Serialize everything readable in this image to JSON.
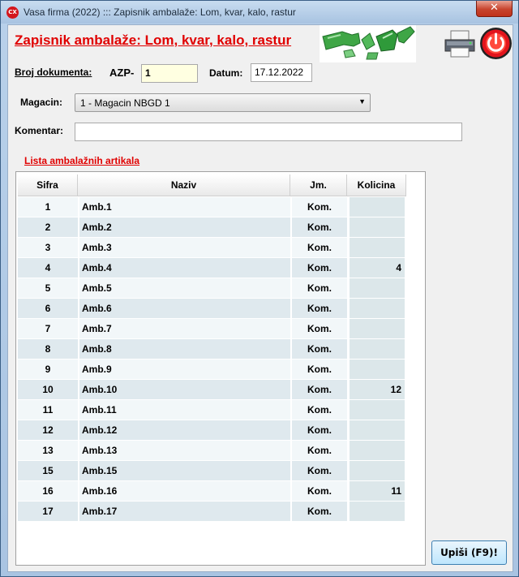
{
  "window": {
    "title": "Vasa firma (2022) ::: Zapisnik ambalaže: Lom, kvar, kalo, rastur",
    "icon_text": "CX",
    "close_label": "✕"
  },
  "header": {
    "title": "Zapisnik ambalaže: Lom, kvar, kalo, rastur",
    "image_icon": "broken-bottles-image",
    "print_icon": "printer-icon",
    "exit_icon": "power-icon"
  },
  "form": {
    "doc_label": "Broj dokumenta:",
    "doc_prefix": "AZP-",
    "doc_number": "1",
    "date_label": "Datum:",
    "date_value": "17.12.2022",
    "warehouse_label": "Magacin:",
    "warehouse_value": "1 - Magacin NBGD 1",
    "comment_label": "Komentar:",
    "comment_value": ""
  },
  "list": {
    "title": "Lista ambalažnih artikala",
    "columns": [
      "Sifra",
      "Naziv",
      "Jm.",
      "Kolicina"
    ],
    "rows": [
      {
        "sifra": "1",
        "naziv": "Amb.1",
        "jm": "Kom.",
        "kolicina": ""
      },
      {
        "sifra": "2",
        "naziv": "Amb.2",
        "jm": "Kom.",
        "kolicina": ""
      },
      {
        "sifra": "3",
        "naziv": "Amb.3",
        "jm": "Kom.",
        "kolicina": ""
      },
      {
        "sifra": "4",
        "naziv": "Amb.4",
        "jm": "Kom.",
        "kolicina": "4"
      },
      {
        "sifra": "5",
        "naziv": "Amb.5",
        "jm": "Kom.",
        "kolicina": ""
      },
      {
        "sifra": "6",
        "naziv": "Amb.6",
        "jm": "Kom.",
        "kolicina": ""
      },
      {
        "sifra": "7",
        "naziv": "Amb.7",
        "jm": "Kom.",
        "kolicina": ""
      },
      {
        "sifra": "8",
        "naziv": "Amb.8",
        "jm": "Kom.",
        "kolicina": ""
      },
      {
        "sifra": "9",
        "naziv": "Amb.9",
        "jm": "Kom.",
        "kolicina": ""
      },
      {
        "sifra": "10",
        "naziv": "Amb.10",
        "jm": "Kom.",
        "kolicina": "12"
      },
      {
        "sifra": "11",
        "naziv": "Amb.11",
        "jm": "Kom.",
        "kolicina": ""
      },
      {
        "sifra": "12",
        "naziv": "Amb.12",
        "jm": "Kom.",
        "kolicina": ""
      },
      {
        "sifra": "13",
        "naziv": "Amb.13",
        "jm": "Kom.",
        "kolicina": ""
      },
      {
        "sifra": "15",
        "naziv": "Amb.15",
        "jm": "Kom.",
        "kolicina": ""
      },
      {
        "sifra": "16",
        "naziv": "Amb.16",
        "jm": "Kom.",
        "kolicina": "11"
      },
      {
        "sifra": "17",
        "naziv": "Amb.17",
        "jm": "Kom.",
        "kolicina": ""
      }
    ]
  },
  "actions": {
    "save_label": "Upiši (F9)!"
  },
  "colors": {
    "title_red": "#e00000",
    "row_even": "#f2f7f9",
    "row_odd": "#dfe9ee",
    "qty_cell": "#dce7ea",
    "doc_number_bg": "#ffffe1"
  }
}
